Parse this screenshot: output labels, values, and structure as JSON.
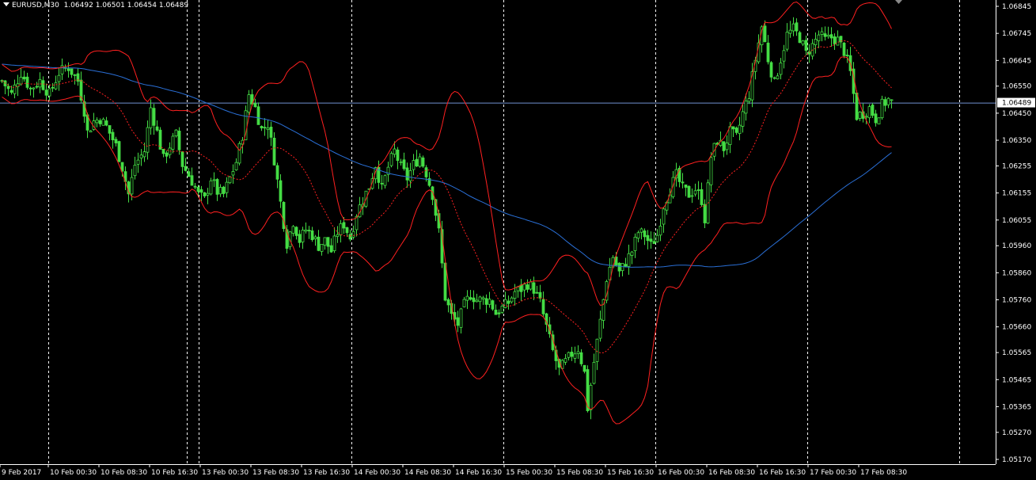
{
  "window": {
    "symbol": "EURUSD",
    "timeframe": "M30",
    "ohlc": [
      "1.06492",
      "1.06501",
      "1.06454",
      "1.06489"
    ]
  },
  "colors": {
    "background": "#000000",
    "axis": "#ffffff",
    "bullish": "#44dd44",
    "bearish": "#44dd44",
    "bollinger": "#ff2020",
    "moving_average": "#2a6fd6",
    "bid_line": "#6f8fd0",
    "price_label_bg": "#ffffff"
  },
  "price_axis": {
    "labels": [
      "1.06845",
      "1.06745",
      "1.06645",
      "1.06550",
      "1.06450",
      "1.06350",
      "1.06255",
      "1.06155",
      "1.06055",
      "1.05960",
      "1.05860",
      "1.05760",
      "1.05660",
      "1.05565",
      "1.05465",
      "1.05365",
      "1.05270",
      "1.05170"
    ],
    "current_price": "1.06489"
  },
  "time_axis": {
    "labels": [
      "9 Feb 2017",
      "10 Feb 00:30",
      "10 Feb 08:30",
      "10 Feb 16:30",
      "13 Feb 00:30",
      "13 Feb 08:30",
      "13 Feb 16:30",
      "14 Feb 00:30",
      "14 Feb 08:30",
      "14 Feb 16:30",
      "15 Feb 00:30",
      "15 Feb 08:30",
      "15 Feb 16:30",
      "16 Feb 00:30",
      "16 Feb 08:30",
      "16 Feb 16:30",
      "17 Feb 00:30",
      "17 Feb 08:30"
    ]
  },
  "chart_data": {
    "type": "candlestick",
    "symbol": "EURUSD",
    "timeframe": "M30",
    "ylim": [
      1.0515,
      1.0689
    ],
    "price_anchors": [
      [
        0,
        1.0657
      ],
      [
        3,
        1.0652
      ],
      [
        6,
        1.066
      ],
      [
        9,
        1.0654
      ],
      [
        12,
        1.0657
      ],
      [
        15,
        1.0652
      ],
      [
        18,
        1.066
      ],
      [
        21,
        1.0662
      ],
      [
        24,
        1.0657
      ],
      [
        26,
        1.0646
      ],
      [
        27,
        1.0638
      ],
      [
        29,
        1.0642
      ],
      [
        31,
        1.0643
      ],
      [
        33,
        1.064
      ],
      [
        36,
        1.0633
      ],
      [
        38,
        1.0625
      ],
      [
        40,
        1.0615
      ],
      [
        42,
        1.0626
      ],
      [
        45,
        1.0631
      ],
      [
        47,
        1.0647
      ],
      [
        49,
        1.0638
      ],
      [
        51,
        1.0628
      ],
      [
        53,
        1.0633
      ],
      [
        55,
        1.0637
      ],
      [
        57,
        1.0626
      ],
      [
        60,
        1.062
      ],
      [
        62,
        1.0615
      ],
      [
        64,
        1.0613
      ],
      [
        66,
        1.0621
      ],
      [
        68,
        1.0616
      ],
      [
        70,
        1.0615
      ],
      [
        72,
        1.0621
      ],
      [
        74,
        1.0627
      ],
      [
        76,
        1.0637
      ],
      [
        78,
        1.0652
      ],
      [
        80,
        1.0647
      ],
      [
        82,
        1.0639
      ],
      [
        84,
        1.0641
      ],
      [
        86,
        1.0628
      ],
      [
        88,
        1.0612
      ],
      [
        90,
        1.0597
      ],
      [
        92,
        1.0605
      ],
      [
        94,
        1.0598
      ],
      [
        96,
        1.0602
      ],
      [
        98,
        1.06
      ],
      [
        100,
        1.0596
      ],
      [
        102,
        1.0598
      ],
      [
        104,
        1.0594
      ],
      [
        106,
        1.0601
      ],
      [
        108,
        1.0604
      ],
      [
        110,
        1.0599
      ],
      [
        112,
        1.0608
      ],
      [
        114,
        1.0613
      ],
      [
        116,
        1.0618
      ],
      [
        118,
        1.0626
      ],
      [
        120,
        1.0617
      ],
      [
        122,
        1.0625
      ],
      [
        124,
        1.0631
      ],
      [
        126,
        1.0625
      ],
      [
        128,
        1.0621
      ],
      [
        130,
        1.0626
      ],
      [
        132,
        1.0629
      ],
      [
        134,
        1.0623
      ],
      [
        136,
        1.0615
      ],
      [
        138,
        1.0601
      ],
      [
        140,
        1.0577
      ],
      [
        142,
        1.057
      ],
      [
        144,
        1.0567
      ],
      [
        146,
        1.0574
      ],
      [
        148,
        1.0578
      ],
      [
        150,
        1.0576
      ],
      [
        152,
        1.0576
      ],
      [
        154,
        1.0576
      ],
      [
        156,
        1.0571
      ],
      [
        158,
        1.0573
      ],
      [
        160,
        1.0575
      ],
      [
        162,
        1.0579
      ],
      [
        164,
        1.058
      ],
      [
        166,
        1.0582
      ],
      [
        168,
        1.058
      ],
      [
        170,
        1.0575
      ],
      [
        172,
        1.0566
      ],
      [
        174,
        1.0557
      ],
      [
        176,
        1.055
      ],
      [
        178,
        1.0553
      ],
      [
        180,
        1.0556
      ],
      [
        182,
        1.0558
      ],
      [
        184,
        1.0549
      ],
      [
        185,
        1.0536
      ],
      [
        187,
        1.0553
      ],
      [
        189,
        1.0568
      ],
      [
        191,
        1.0584
      ],
      [
        193,
        1.0592
      ],
      [
        195,
        1.0586
      ],
      [
        197,
        1.059
      ],
      [
        199,
        1.0594
      ],
      [
        201,
        1.0601
      ],
      [
        203,
        1.06
      ],
      [
        205,
        1.0596
      ],
      [
        207,
        1.06
      ],
      [
        209,
        1.0611
      ],
      [
        211,
        1.0617
      ],
      [
        213,
        1.0622
      ],
      [
        215,
        1.0617
      ],
      [
        217,
        1.0615
      ],
      [
        219,
        1.0617
      ],
      [
        221,
        1.0613
      ],
      [
        222,
        1.0606
      ],
      [
        224,
        1.0629
      ],
      [
        226,
        1.0635
      ],
      [
        228,
        1.0632
      ],
      [
        230,
        1.0638
      ],
      [
        232,
        1.0636
      ],
      [
        234,
        1.0645
      ],
      [
        236,
        1.0652
      ],
      [
        238,
        1.0665
      ],
      [
        240,
        1.0677
      ],
      [
        242,
        1.0665
      ],
      [
        244,
        1.0656
      ],
      [
        246,
        1.0665
      ],
      [
        248,
        1.0674
      ],
      [
        250,
        1.0676
      ],
      [
        252,
        1.0673
      ],
      [
        254,
        1.0667
      ],
      [
        256,
        1.067
      ],
      [
        258,
        1.0674
      ],
      [
        260,
        1.0672
      ],
      [
        262,
        1.0673
      ],
      [
        264,
        1.0672
      ],
      [
        266,
        1.0668
      ],
      [
        268,
        1.066
      ],
      [
        270,
        1.0644
      ],
      [
        272,
        1.0645
      ],
      [
        274,
        1.0647
      ],
      [
        276,
        1.0643
      ],
      [
        278,
        1.0648
      ],
      [
        280,
        1.065
      ],
      [
        281,
        1.0649
      ]
    ]
  }
}
